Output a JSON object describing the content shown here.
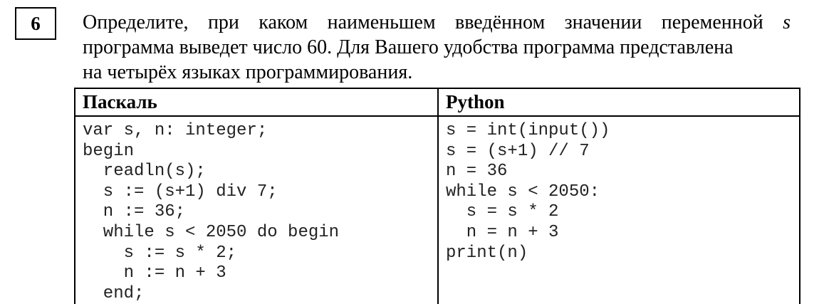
{
  "task": {
    "number": "6",
    "text_line1_a": "Определите, при каком наименьшем введённом значении переменной ",
    "text_line1_var": "s",
    "text_line2": "программа выведет число 60. Для Вашего удобства программа представлена",
    "text_line3": "на четырёх языках программирования."
  },
  "table": {
    "headers": [
      "Паскаль",
      "Python"
    ],
    "pascal_lines": [
      "var s, n: integer;",
      "begin",
      "  readln(s);",
      "  s := (s+1) div 7;",
      "  n := 36;",
      "  while s < 2050 do begin",
      "    s := s * 2;",
      "    n := n + 3",
      "  end;"
    ],
    "python_lines": [
      "s = int(input())",
      "s = (s+1) // 7",
      "n = 36",
      "while s < 2050:",
      "  s = s * 2",
      "  n = n + 3",
      "print(n)"
    ]
  }
}
